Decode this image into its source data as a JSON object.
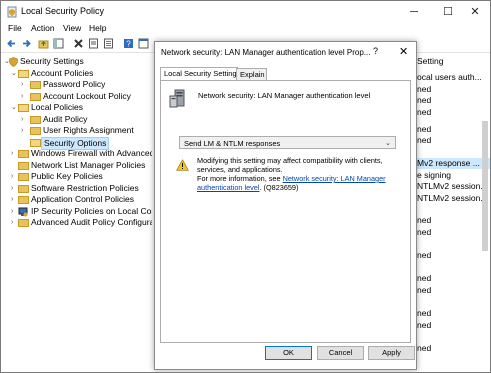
{
  "window": {
    "title": "Local Security Policy"
  },
  "menu": [
    "File",
    "Action",
    "View",
    "Help"
  ],
  "tree": {
    "items": [
      {
        "label": "Security Settings",
        "expander": "⌄"
      },
      {
        "label": "Account Policies",
        "expander": "⌄"
      },
      {
        "label": "Password Policy",
        "expander": "›"
      },
      {
        "label": "Account Lockout Policy",
        "expander": "›"
      },
      {
        "label": "Local Policies",
        "expander": "⌄"
      },
      {
        "label": "Audit Policy",
        "expander": "›"
      },
      {
        "label": "User Rights Assignment",
        "expander": "›"
      },
      {
        "label": "Security Options",
        "expander": ""
      },
      {
        "label": "Windows Firewall with Advanced Se",
        "expander": "›"
      },
      {
        "label": "Network List Manager Policies",
        "expander": ""
      },
      {
        "label": "Public Key Policies",
        "expander": "›"
      },
      {
        "label": "Software Restriction Policies",
        "expander": "›"
      },
      {
        "label": "Application Control Policies",
        "expander": "›"
      },
      {
        "label": "IP Security Policies on Local Comput",
        "expander": "›"
      },
      {
        "label": "Advanced Audit Policy Configuratio",
        "expander": "›"
      }
    ]
  },
  "right_pane": {
    "rows": [
      "Setting",
      "ocal users auth...",
      "ned",
      "ned",
      "ned",
      "ned",
      "ned",
      "Mv2 response ...",
      "e signing",
      "NTLMv2 session...",
      "NTLMv2 session...",
      "ned",
      "ned",
      "ned",
      "ned",
      "ned",
      "ned",
      "ned",
      "ned"
    ]
  },
  "dialog": {
    "title": "Network security: LAN Manager authentication level Prop...",
    "help_glyph": "?",
    "close_glyph": "✕",
    "tabs": [
      "Local Security Setting",
      "Explain"
    ],
    "policy_name": "Network security: LAN Manager authentication level",
    "selected_value": "Send LM & NTLM responses",
    "warning": {
      "text": "Modifying this setting may affect compatibility with clients, services, and applications.",
      "more_info_prefix": "For more information, see",
      "link_text": "Network security: LAN Manager authentication level",
      "suffix": ". (Q823659)"
    },
    "buttons": {
      "ok": "OK",
      "cancel": "Cancel",
      "apply": "Apply"
    }
  }
}
